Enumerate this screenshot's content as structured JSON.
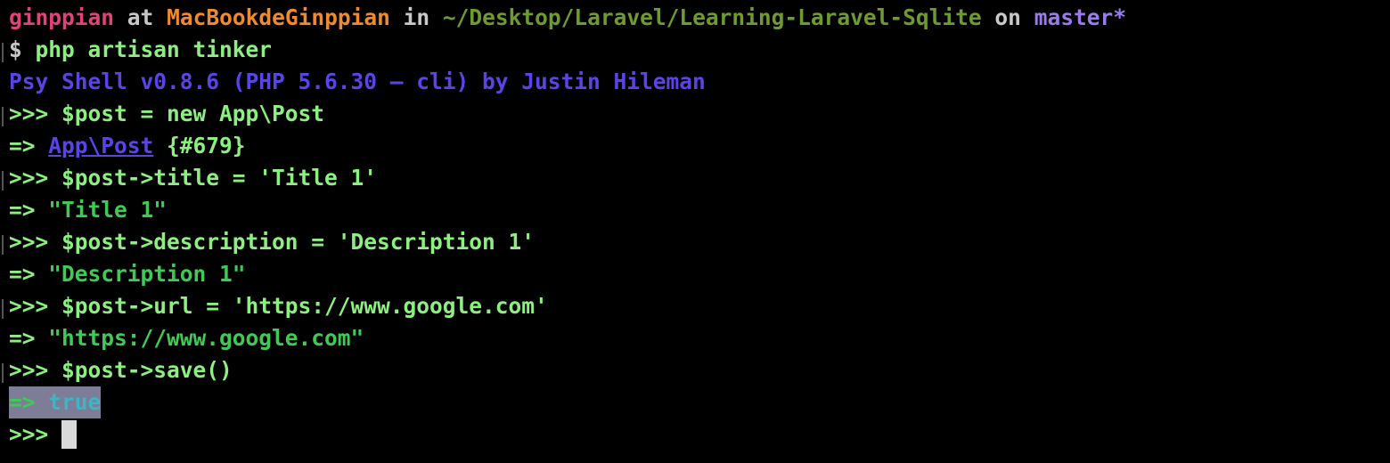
{
  "window": {
    "background": "#000000"
  },
  "prompt": {
    "user": "ginppian",
    "at": "at",
    "host": "MacBookdeGinppian",
    "in": "in",
    "path": "~/Desktop/Laravel/Learning-Laravel-Sqlite",
    "on": "on",
    "branch": "master*"
  },
  "lines": {
    "shell_cmd_prefix": "$ ",
    "shell_cmd": "php artisan tinker",
    "banner": "Psy Shell v0.8.6 (PHP 5.6.30 — cli) by Justin Hileman",
    "in1": "$post = new App\\Post",
    "out1_arrow": "=> ",
    "out1_class": "App\\Post",
    "out1_id": " {#679}",
    "in2": "$post->title = 'Title 1'",
    "out2": "\"Title 1\"",
    "in3": "$post->description = 'Description 1'",
    "out3": "\"Description 1\"",
    "in4": "$post->url = 'https://www.google.com'",
    "out4": "\"https://www.google.com\"",
    "in5": "$post->save()",
    "out5_arrow": "=> ",
    "out5_value": "true",
    "prompt_marker": ">>> ",
    "result_marker": "=> "
  },
  "colors": {
    "user": "#e2427b",
    "host": "#f08a2e",
    "path": "#6e9a2f",
    "branch": "#9a7be8",
    "command": "#8cf07f",
    "string": "#3fca55",
    "banner": "#5a44e8",
    "selection": "#7d7d98",
    "boolean": "#3cb6c4"
  }
}
